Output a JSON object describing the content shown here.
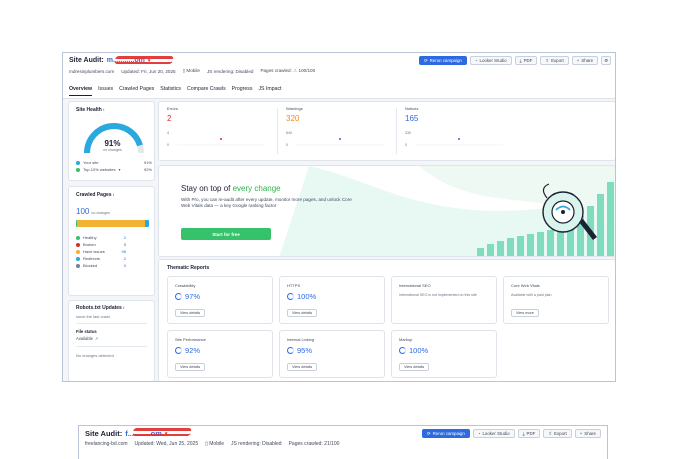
{
  "audit": {
    "title_prefix": "Site Audit:",
    "domain": "m...........om",
    "domain_caret": "▾",
    "site": "mdresinplumbers.com",
    "updated": "Updated: Fri, Jun 20, 2025",
    "device": "Mobile",
    "js": "JS rendering: Disabled",
    "pages_label": "Pages crawled:",
    "pages_value": "100/100"
  },
  "buttons": {
    "rerun": "Rerun campaign",
    "looker": "Looker Studio",
    "pdf": "PDF",
    "export": "Export",
    "share": "Share"
  },
  "tabs": [
    "Overview",
    "Issues",
    "Crawled Pages",
    "Statistics",
    "Compare Crawls",
    "Progress",
    "JS Impact"
  ],
  "site_health": {
    "title": "Site Health",
    "info": "i",
    "score": "91%",
    "sub": "no changes",
    "legend": [
      {
        "label": "Your site",
        "value": "91%",
        "color": "#2aa8e0"
      },
      {
        "label": "Top-10% websites",
        "value": "92%",
        "color": "#35c26a"
      }
    ],
    "percent": 91
  },
  "crawled": {
    "title": "Crawled Pages",
    "info": "i",
    "count": "100",
    "sub": "no changes",
    "legend": [
      {
        "label": "Healthy",
        "value": "2",
        "color": "#35c26a"
      },
      {
        "label": "Broken",
        "value": "0",
        "color": "#e02a2a"
      },
      {
        "label": "Have issues",
        "value": "96",
        "color": "#f2b233"
      },
      {
        "label": "Redirects",
        "value": "2",
        "color": "#2aa8e0"
      },
      {
        "label": "Blocked",
        "value": "0",
        "color": "#7a8194"
      }
    ]
  },
  "robots": {
    "title": "Robots.txt Updates",
    "info": "i",
    "since": "since the last crawl",
    "file_label": "File status",
    "file_value": "Available",
    "no_changes": "No changes detected"
  },
  "stats": [
    {
      "label": "Errors",
      "value": "2",
      "color": "#e02a2a",
      "ymax": "4",
      "ymin": "0"
    },
    {
      "label": "Warnings",
      "value": "320",
      "color": "#f08a24",
      "ymax": "640",
      "ymin": "0"
    },
    {
      "label": "Notices",
      "value": "165",
      "color": "#2d6ae0",
      "ymax": "330",
      "ymin": "0"
    }
  ],
  "promo": {
    "heading_plain": "Stay on top of ",
    "heading_em": "every change",
    "body": "With Pro, you can re-audit after every update, monitor more pages, and unlock Core Web Vitals data — a key Google ranking factor",
    "cta": "Start for free"
  },
  "thematic": {
    "title": "Thematic Reports",
    "items": [
      {
        "name": "Crawlability",
        "score": "97%",
        "btn": "View details"
      },
      {
        "name": "HTTPS",
        "score": "100%",
        "btn": "View details"
      },
      {
        "name": "International SEO",
        "note": "International SEO is not implemented on this site",
        "btn": ""
      },
      {
        "name": "Core Web Vitals",
        "note": "Available with a paid plan",
        "btn": "View more"
      },
      {
        "name": "Site Performance",
        "score": "92%",
        "btn": "View details"
      },
      {
        "name": "Internal Linking",
        "score": "95%",
        "btn": "View details"
      },
      {
        "name": "Markup",
        "score": "100%",
        "btn": "View details"
      }
    ]
  },
  "audit2": {
    "title_prefix": "Site Audit:",
    "domain": "f...........om",
    "domain_caret": "▾",
    "site": "freelancing-bd.com",
    "updated": "Updated: Wed, Jun 25, 2025",
    "device": "Mobile",
    "js": "JS rendering: Disabled",
    "pages": "Pages crawled: 21/100"
  },
  "colors": {
    "accent": "#2d6ae0",
    "green": "#35c26a",
    "red": "#e02a2a",
    "orange": "#f08a24"
  }
}
